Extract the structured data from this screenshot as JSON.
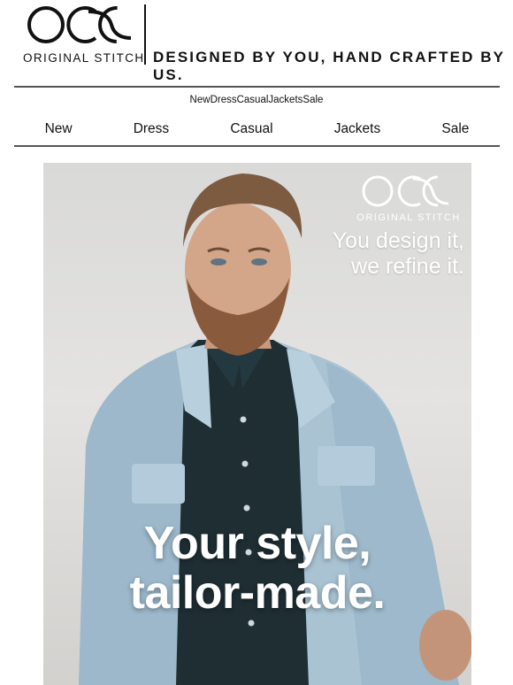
{
  "header": {
    "brand_name": "ORIGINAL STITCH",
    "tagline": "DESIGNED BY YOU, HAND CRAFTED BY US.",
    "logo_icon": "ocs-logo-icon"
  },
  "nav_compact": {
    "items": [
      "New",
      "Dress",
      "Casual",
      "Jackets",
      "Sale"
    ]
  },
  "nav_main": {
    "items": [
      "New",
      "Dress",
      "Casual",
      "Jackets",
      "Sale"
    ]
  },
  "hero": {
    "brand_name": "ORIGINAL STITCH",
    "subheadline_line1": "You design it,",
    "subheadline_line2": "we refine it.",
    "headline_line1": "Your style,",
    "headline_line2": "tailor-made.",
    "image_description_icon": "model-in-denim-jacket-photo"
  },
  "colors": {
    "text": "#111111",
    "rule": "#555555",
    "hero_text": "#ffffff",
    "denim": "#a9c3d3",
    "shirt": "#1e2e33"
  }
}
